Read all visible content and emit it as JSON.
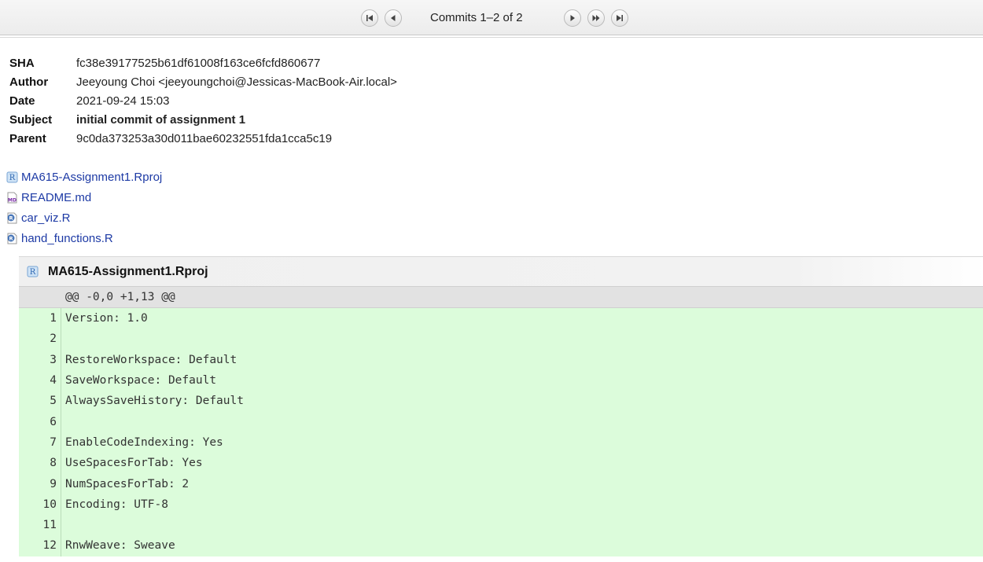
{
  "navigation": {
    "counter": "Commits 1–2 of 2",
    "buttons": [
      "first-page-icon",
      "previous-page-icon",
      "next-page-icon",
      "fast-forward-icon",
      "last-page-icon"
    ]
  },
  "commit": {
    "sha_label": "SHA",
    "sha": "fc38e39177525b61df61008f163ce6fcfd860677",
    "author_label": "Author",
    "author": "Jeeyoung Choi <jeeyoungchoi@Jessicas-MacBook-Air.local>",
    "date_label": "Date",
    "date": "2021-09-24 15:03",
    "subject_label": "Subject",
    "subject": "initial commit of assignment 1",
    "parent_label": "Parent",
    "parent": "9c0da373253a30d011bae60232551fda1cca5c19"
  },
  "files": [
    {
      "name": "MA615-Assignment1.Rproj",
      "icon": "rproj-icon"
    },
    {
      "name": "README.md",
      "icon": "markdown-icon"
    },
    {
      "name": "car_viz.R",
      "icon": "r-script-icon"
    },
    {
      "name": "hand_functions.R",
      "icon": "r-script-icon"
    }
  ],
  "diff": {
    "file": "MA615-Assignment1.Rproj",
    "hunk": "@@ -0,0 +1,13 @@",
    "lines": [
      {
        "n": "1",
        "text": "Version: 1.0"
      },
      {
        "n": "2",
        "text": ""
      },
      {
        "n": "3",
        "text": "RestoreWorkspace: Default"
      },
      {
        "n": "4",
        "text": "SaveWorkspace: Default"
      },
      {
        "n": "5",
        "text": "AlwaysSaveHistory: Default"
      },
      {
        "n": "6",
        "text": ""
      },
      {
        "n": "7",
        "text": "EnableCodeIndexing: Yes"
      },
      {
        "n": "8",
        "text": "UseSpacesForTab: Yes"
      },
      {
        "n": "9",
        "text": "NumSpacesForTab: 2"
      },
      {
        "n": "10",
        "text": "Encoding: UTF-8"
      },
      {
        "n": "11",
        "text": ""
      },
      {
        "n": "12",
        "text": "RnwWeave: Sweave"
      }
    ]
  },
  "colors": {
    "added_line_bg": "#dcfcdb",
    "hunk_bg": "#e2e2e2",
    "link": "#1d3aa5"
  }
}
